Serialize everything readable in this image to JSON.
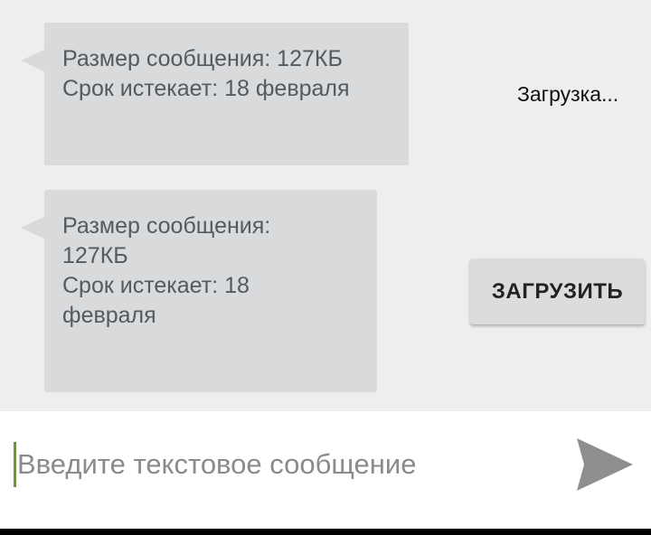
{
  "messages": [
    {
      "lines": [
        "Размер сообщения: 127КБ",
        "Срок истекает: 18 февраля"
      ]
    },
    {
      "lines": [
        "Размер сообщения:",
        "127КБ",
        "Срок истекает: 18",
        "февраля"
      ]
    }
  ],
  "status": {
    "loading_text": "Загрузка..."
  },
  "download_button": {
    "label": "ЗАГРУЗИТЬ"
  },
  "composer": {
    "placeholder": "Введите текстовое сообщение",
    "value": ""
  },
  "icons": {
    "send": "send-arrow-icon"
  },
  "colors": {
    "bubble": "#d8dadc",
    "background": "#eeeeee",
    "cursor": "#6a9a28",
    "send_icon": "#8f8f8f"
  }
}
